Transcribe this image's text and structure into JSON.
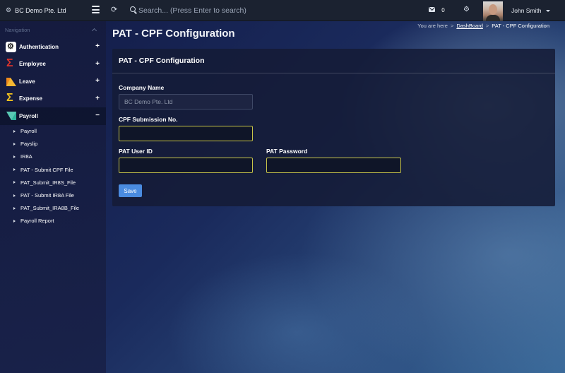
{
  "topbar": {
    "company": "BC Demo Pte. Ltd",
    "search_placeholder": "Search... (Press Enter to search)",
    "mail_count": "0",
    "user_name": "John Smith"
  },
  "sidebar": {
    "heading": "Navigation",
    "items": [
      {
        "label": "Authentication",
        "toggle": "+"
      },
      {
        "label": "Employee",
        "toggle": "+"
      },
      {
        "label": "Leave",
        "toggle": "+"
      },
      {
        "label": "Expense",
        "toggle": "+"
      },
      {
        "label": "Payroll",
        "toggle": "−"
      }
    ],
    "subitems": [
      {
        "label": "Payroll"
      },
      {
        "label": "Payslip"
      },
      {
        "label": "IR8A"
      },
      {
        "label": "PAT - Submit CPF File"
      },
      {
        "label": "PAT_Submit_IR8S_File"
      },
      {
        "label": "PAT - Submit IR8A File"
      },
      {
        "label": "PAT_Submit_IRA8B_File"
      },
      {
        "label": "Payroll Report"
      }
    ]
  },
  "page": {
    "title": "PAT - CPF Configuration",
    "breadcrumb": {
      "prefix": "You are here",
      "sep1": ">",
      "link": "DashBoard",
      "sep2": ">",
      "current": "PAT - CPF Configuration"
    }
  },
  "panel": {
    "title": "PAT - CPF Configuration",
    "company_label": "Company Name",
    "company_value": "BC Demo Pte. Ltd",
    "cpf_label": "CPF Submission No.",
    "cpf_value": "",
    "user_id_label": "PAT User ID",
    "user_id_value": "",
    "password_label": "PAT Password",
    "password_value": "",
    "save_label": "Save"
  }
}
